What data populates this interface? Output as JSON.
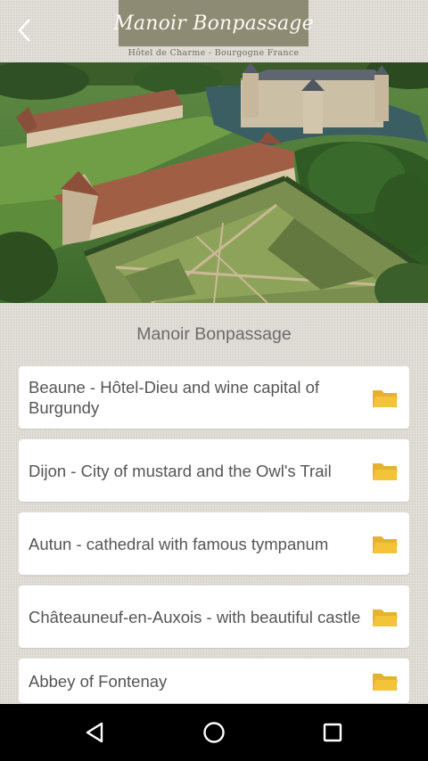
{
  "header": {
    "back_icon": "chevron-left-icon",
    "logo_text": "Manoir Bonpassage",
    "logo_subtitle": "Hôtel de Charme - Bourgogne France"
  },
  "hero": {
    "image": "aerial-photo-chateau-and-gardens"
  },
  "section_title": "Manoir Bonpassage",
  "items": [
    {
      "label": "Beaune - Hôtel-Dieu and wine capital of Burgundy",
      "icon": "folder-icon"
    },
    {
      "label": "Dijon - City of mustard and the Owl's Trail",
      "icon": "folder-icon"
    },
    {
      "label": "Autun - cathedral with famous tympanum",
      "icon": "folder-icon"
    },
    {
      "label": "Châteauneuf-en-Auxois -  with beautiful castle",
      "icon": "folder-icon"
    },
    {
      "label": "Abbey of Fontenay",
      "icon": "folder-icon"
    }
  ],
  "navbar": {
    "back": "nav-back-icon",
    "home": "nav-home-icon",
    "recents": "nav-recents-icon"
  },
  "colors": {
    "logo_bg": "#8d8b73",
    "folder": "#f3c43a",
    "background": "#dedbd3"
  }
}
